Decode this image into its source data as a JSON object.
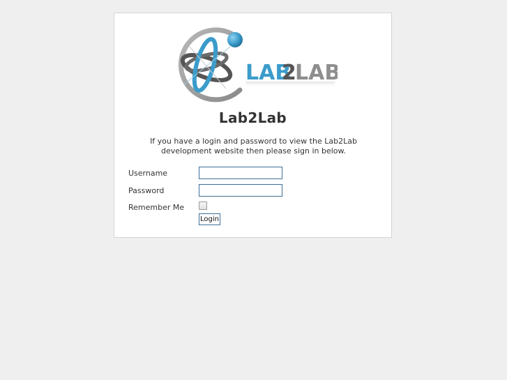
{
  "brand": {
    "logo_text_part1": "LAB",
    "logo_text_part2": "2",
    "logo_text_part3": "LAB",
    "accent_blue": "#3b9ccb",
    "logo_gray": "#8e8e8e",
    "logo_dark": "#555555"
  },
  "page": {
    "title": "Lab2Lab",
    "intro": "If you have a login and password to view the Lab2Lab development website then please sign in below."
  },
  "form": {
    "username_label": "Username",
    "username_value": "",
    "password_label": "Password",
    "password_value": "",
    "remember_label": "Remember Me",
    "remember_checked": false,
    "login_label": "Login"
  }
}
